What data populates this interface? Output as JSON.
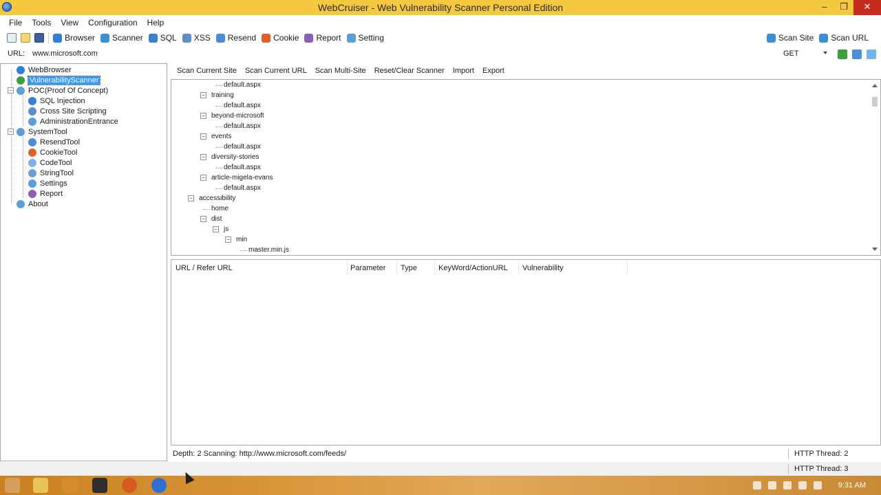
{
  "window": {
    "title": "WebCruiser - Web Vulnerability Scanner Personal Edition",
    "controls": [
      "–",
      "❐",
      "✕"
    ]
  },
  "menu": [
    "File",
    "Tools",
    "View",
    "Configuration",
    "Help"
  ],
  "toolbar": {
    "buttons": [
      {
        "label": "Browser",
        "icon": "globe-icon",
        "color": "#2f7fd9"
      },
      {
        "label": "Scanner",
        "icon": "scan-icon",
        "color": "#3c8fd4"
      },
      {
        "label": "SQL",
        "icon": "database-icon",
        "color": "#3a7fd0"
      },
      {
        "label": "XSS",
        "icon": "xss-icon",
        "color": "#5b8fc9"
      },
      {
        "label": "Resend",
        "icon": "resend-icon",
        "color": "#4b8cd8"
      },
      {
        "label": "Cookie",
        "icon": "cookie-icon",
        "color": "#e0602a"
      },
      {
        "label": "Report",
        "icon": "report-icon",
        "color": "#8a5fb5"
      },
      {
        "label": "Setting",
        "icon": "gear-icon",
        "color": "#5a9fd8"
      }
    ],
    "right_buttons": [
      {
        "label": "Scan Site",
        "icon": "scan-site-icon",
        "color": "#3c8fd4"
      },
      {
        "label": "Scan URL",
        "icon": "scan-url-icon",
        "color": "#3c8fd4"
      }
    ]
  },
  "urlbar": {
    "label": "URL:",
    "value": "www.microsoft.com",
    "method": "GET"
  },
  "left_tree": [
    {
      "label": "WebBrowser",
      "icon": "globe-icon",
      "color": "#2f7fd9",
      "level": 1
    },
    {
      "label": "VulnerabilityScanner",
      "icon": "check-icon",
      "color": "#3aa13a",
      "level": 1,
      "selected": true
    },
    {
      "label": "POC(Proof Of Concept)",
      "icon": "poc-icon",
      "color": "#5a9fd8",
      "level": 1
    },
    {
      "label": "SQL Injection",
      "icon": "database-icon",
      "color": "#3a7fd0",
      "level": 2
    },
    {
      "label": "Cross Site Scripting",
      "icon": "xss-icon",
      "color": "#5b8fc9",
      "level": 2
    },
    {
      "label": "AdministrationEntrance",
      "icon": "admin-icon",
      "color": "#5a9fd8",
      "level": 2
    },
    {
      "label": "SystemTool",
      "icon": "tool-icon",
      "color": "#5a9fd8",
      "level": 1
    },
    {
      "label": "ResendTool",
      "icon": "resend-icon",
      "color": "#4b8cd8",
      "level": 2
    },
    {
      "label": "CookieTool",
      "icon": "cookie-icon",
      "color": "#e0602a",
      "level": 2
    },
    {
      "label": "CodeTool",
      "icon": "code-icon",
      "color": "#7fb1e8",
      "level": 2
    },
    {
      "label": "StringTool",
      "icon": "string-icon",
      "color": "#6aa0d6",
      "level": 2
    },
    {
      "label": "Settings",
      "icon": "gear-icon",
      "color": "#5a9fd8",
      "level": 2
    },
    {
      "label": "Report",
      "icon": "report-icon",
      "color": "#8a5fb5",
      "level": 2
    },
    {
      "label": "About",
      "icon": "info-icon",
      "color": "#5a9fd8",
      "level": 1
    }
  ],
  "actions": [
    "Scan Current Site",
    "Scan Current URL",
    "Scan Multi-Site",
    "Reset/Clear Scanner",
    "Import",
    "Export"
  ],
  "site_tree": [
    {
      "label": "default.aspx",
      "level": 4
    },
    {
      "label": "training",
      "level": 3,
      "expander": "-"
    },
    {
      "label": "default.aspx",
      "level": 4
    },
    {
      "label": "beyond-microsoft",
      "level": 3,
      "expander": "-"
    },
    {
      "label": "default.aspx",
      "level": 4
    },
    {
      "label": "events",
      "level": 3,
      "expander": "-"
    },
    {
      "label": "default.aspx",
      "level": 4
    },
    {
      "label": "diversity-stories",
      "level": 3,
      "expander": "-"
    },
    {
      "label": "default.aspx",
      "level": 4
    },
    {
      "label": "article-migela-evans",
      "level": 3,
      "expander": "-"
    },
    {
      "label": "default.aspx",
      "level": 4
    },
    {
      "label": "accessibility",
      "level": 2,
      "expander": "-"
    },
    {
      "label": "home",
      "level": 3
    },
    {
      "label": "dist",
      "level": 3,
      "expander": "-"
    },
    {
      "label": "js",
      "level": 4,
      "expander": "-"
    },
    {
      "label": "min",
      "level": 5,
      "expander": "-"
    },
    {
      "label": "master.min.js",
      "level": 6
    }
  ],
  "results": {
    "columns": [
      "URL / Refer URL",
      "Parameter",
      "Type",
      "KeyWord/ActionURL",
      "Vulnerability"
    ]
  },
  "status": {
    "scanning": "Depth: 2  Scanning: http://www.microsoft.com/feeds/",
    "thread1": "HTTP Thread: 2",
    "thread2": "HTTP Thread: 3"
  },
  "taskbar": {
    "time": "9:31 AM",
    "items": [
      "windows-start-icon",
      "file-explorer-icon",
      "store-icon",
      "terminal-icon",
      "firefox-icon",
      "webcruiser-icon"
    ]
  }
}
